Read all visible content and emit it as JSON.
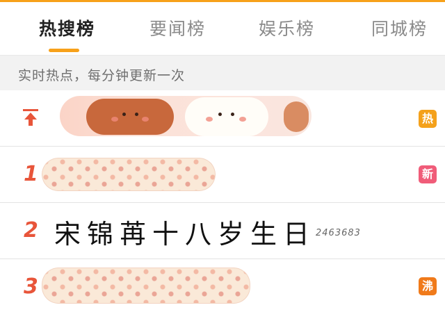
{
  "tabs": [
    {
      "label": "热搜榜",
      "active": true
    },
    {
      "label": "要闻榜",
      "active": false
    },
    {
      "label": "娱乐榜",
      "active": false
    },
    {
      "label": "同城榜",
      "active": false
    }
  ],
  "subtitle": "实时热点，每分钟更新一次",
  "rows": [
    {
      "rank": "",
      "pinned": true,
      "title": "",
      "heat": "",
      "badge": "热",
      "badge_color": "#f4a11b"
    },
    {
      "rank": "1",
      "pinned": false,
      "title": "",
      "heat": "",
      "badge": "新",
      "badge_color": "#f05c79"
    },
    {
      "rank": "2",
      "pinned": false,
      "title": "宋锦苒十八岁生日",
      "heat": "2463683",
      "badge": "",
      "badge_color": ""
    },
    {
      "rank": "3",
      "pinned": false,
      "title": "",
      "heat": "",
      "badge": "沸",
      "badge_color": "#f07a1a"
    }
  ],
  "colors": {
    "accent": "#f7a11a",
    "rank": "#e8553a"
  },
  "icons": {
    "pinned": "pin-top-arrow-icon"
  }
}
